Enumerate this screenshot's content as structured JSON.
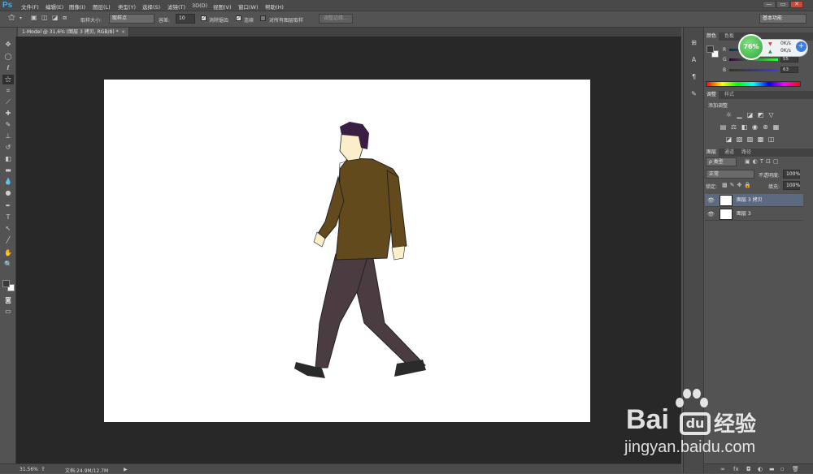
{
  "app": {
    "logo": "Ps",
    "window_buttons": [
      "—",
      "▭",
      "✕"
    ]
  },
  "menu": [
    "文件(F)",
    "编辑(E)",
    "图像(I)",
    "图层(L)",
    "类型(Y)",
    "选择(S)",
    "滤镜(T)",
    "3D(D)",
    "视图(V)",
    "窗口(W)",
    "帮助(H)"
  ],
  "options": {
    "sample_size_label": "取样大小:",
    "sample_size_value": "取样点",
    "tolerance_label": "容差:",
    "tolerance_value": "10",
    "antialias_label": "消除锯齿",
    "contiguous_label": "连续",
    "sample_all_label": "对所有图层取样",
    "refine_edge_label": "调整边缘...",
    "workspace": "基本功能"
  },
  "document_tab": {
    "title": "1-Model @ 31.6% (图层 3 拷贝, RGB/8) *",
    "close": "×"
  },
  "status": {
    "zoom": "31.56%",
    "doc_info": "文档:24.9M/12.7M"
  },
  "color_panel": {
    "tabs": [
      "颜色",
      "色板"
    ],
    "channels": [
      {
        "label": "R",
        "value": ""
      },
      {
        "label": "G",
        "value": "55"
      },
      {
        "label": "B",
        "value": "63"
      }
    ]
  },
  "speed_widget": {
    "percent": "76%",
    "up": "0K/s",
    "down": "0K/s"
  },
  "adjustments_panel": {
    "tabs": [
      "调整",
      "样式"
    ],
    "title": "添加调整"
  },
  "layers_panel": {
    "tabs": [
      "图层",
      "通道",
      "路径"
    ],
    "filter": "ρ 类型",
    "blend_mode": "正常",
    "opacity_label": "不透明度:",
    "opacity_value": "100%",
    "lock_label": "锁定:",
    "fill_label": "填充:",
    "fill_value": "100%",
    "layers": [
      {
        "name": "图层 3 拷贝",
        "selected": true
      },
      {
        "name": "图层 3",
        "selected": false
      }
    ],
    "footer_icons": [
      "link-icon",
      "fx-icon",
      "mask-icon",
      "adjustment-icon",
      "group-icon",
      "new-layer-icon",
      "trash-icon"
    ],
    "footer_glyphs": [
      "∞",
      "fx",
      "◘",
      "◐",
      "▬",
      "▫",
      "🗑"
    ]
  },
  "watermark": {
    "brand": "Bai",
    "suffix": "经验",
    "url": "jingyan.baidu.com"
  },
  "colors": {
    "jacket": "#634a1c",
    "pants": "#4a3c41",
    "hair": "#3a1e43",
    "skin": "#fbeec8",
    "accent": "#4aa7e8"
  }
}
